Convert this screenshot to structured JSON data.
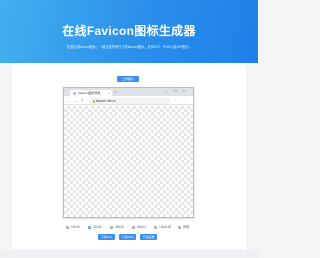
{
  "hero": {
    "title": "在线Favicon图标生成器",
    "subtitle": "在线生成favicon图标，一键生成所有尺寸的favicon图标，支持JPG、PNG以及GIF格式。"
  },
  "upload_label": "上传图片",
  "browser": {
    "tab_title": "Favicon图标预览",
    "tab_close": "×",
    "new_tab": "+",
    "minimize": "–",
    "maximize": "□",
    "close": "×",
    "back": "←",
    "forward": "→",
    "reload": "C",
    "url": "favicon.net.cn",
    "lock": "🔒",
    "star": "☆",
    "menu": "⋮"
  },
  "sizes": [
    {
      "label": "16x16",
      "selected": false
    },
    {
      "label": "32x32",
      "selected": true
    },
    {
      "label": "48x48",
      "selected": false
    },
    {
      "label": "64x64",
      "selected": false
    },
    {
      "label": "128x128",
      "selected": false
    },
    {
      "label": "其他",
      "selected": false
    }
  ],
  "download": {
    "btn1": "下载ICO",
    "btn2": "下载PNG",
    "btn3": "下载全部"
  },
  "colors": {
    "accent": "#3b8ff0",
    "hero_start": "#43b0ef",
    "hero_end": "#1f7fe8"
  }
}
